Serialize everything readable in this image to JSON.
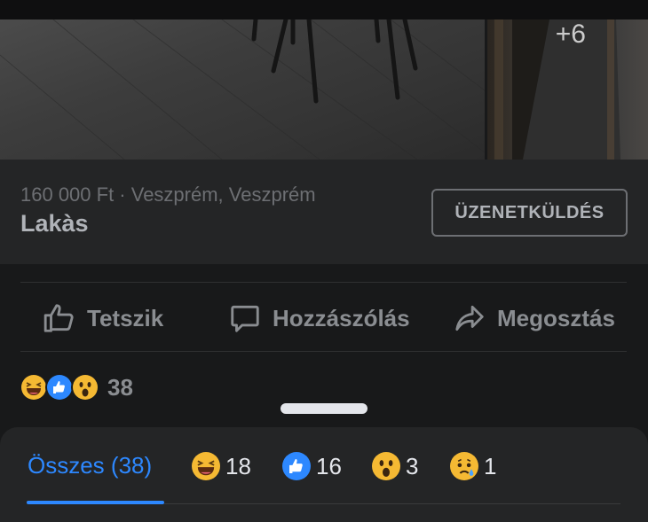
{
  "photos": {
    "more_count": "+6"
  },
  "listing": {
    "price_location": "160 000 Ft · Veszprém, Veszprém",
    "title": "Lakàs",
    "message_button": "ÜZENETKÜLDÉS"
  },
  "actions": {
    "like": "Tetszik",
    "comment": "Hozzászólás",
    "share": "Megosztás"
  },
  "reactions_summary": {
    "icons": [
      "haha-icon",
      "like-icon",
      "wow-icon"
    ],
    "count": "38"
  },
  "reaction_tabs": [
    {
      "label": "Összes (38)",
      "icon": null,
      "active": true
    },
    {
      "label": "18",
      "icon": "haha-icon",
      "active": false
    },
    {
      "label": "16",
      "icon": "like-icon",
      "active": false
    },
    {
      "label": "3",
      "icon": "wow-icon",
      "active": false
    },
    {
      "label": "1",
      "icon": "sad-icon",
      "active": false
    }
  ],
  "colors": {
    "accent": "#2d88ff",
    "background": "#18191a",
    "card": "#242526"
  }
}
